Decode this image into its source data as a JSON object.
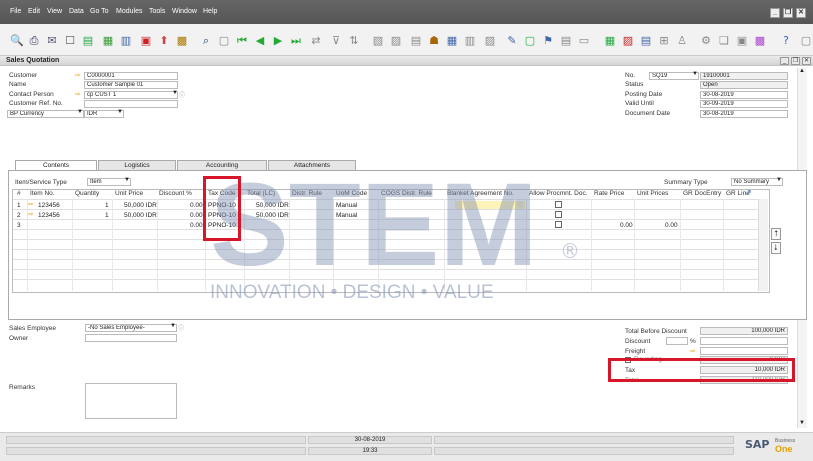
{
  "menu": [
    "File",
    "Edit",
    "View",
    "Data",
    "Go To",
    "Modules",
    "Tools",
    "Window",
    "Help"
  ],
  "toolbar_icons": [
    "print-preview-icon",
    "print-icon",
    "email-icon",
    "word-icon",
    "pdf-icon",
    "excel-icon",
    "launch-icon",
    "lock-icon",
    "filter-icon",
    "first-record-icon",
    "previous-record-icon",
    "next-record-icon",
    "last-record-icon",
    "refresh-icon",
    "find-icon",
    "base-document-icon",
    "target-document-icon",
    "gross-profit-icon",
    "payment-icon",
    "alerts-icon",
    "calendar-icon",
    "settings-icon",
    "tree-icon",
    "messages-icon",
    "form-settings-icon",
    "help-icon"
  ],
  "window": {
    "title": "Sales Quotation"
  },
  "header_left": {
    "customer_label": "Customer",
    "customer_value": "C0000001",
    "name_label": "Name",
    "name_value": "Customer Sample 01",
    "contact_label": "Contact Person",
    "contact_value": "cp CUST 1",
    "ref_label": "Customer Ref. No.",
    "ref_value": "",
    "currency_label": "BP Currency",
    "currency_value": "IDR"
  },
  "header_right": {
    "no_label": "No.",
    "series": "SQ19",
    "number": "19100001",
    "status_label": "Status",
    "status_value": "Open",
    "posting_label": "Posting Date",
    "posting_value": "30-08-2019",
    "valid_label": "Valid Until",
    "valid_value": "30-09-2019",
    "docdate_label": "Document Date",
    "docdate_value": "30-08-2019"
  },
  "tabs": [
    "Contents",
    "Logistics",
    "Accounting",
    "Attachments"
  ],
  "contents": {
    "item_type_label": "Item/Service Type",
    "item_type_value": "Item",
    "summary_label": "Summary Type",
    "summary_value": "No Summary",
    "columns": [
      "#",
      "Item No.",
      "Quantity",
      "Unit Price",
      "Discount %",
      "Tax Code",
      "Total (LC)",
      "Distr. Rule",
      "UoM Code",
      "COGS Distr. Rule",
      "Blanket Agreement No.",
      "Allow Procmnt. Doc.",
      "Rate Price",
      "Unit Prices",
      "GR DocEntry",
      "GR Line"
    ],
    "rows": [
      {
        "num": "1",
        "item": "123456",
        "qty": "1",
        "price": "50,000 IDR",
        "disc": "0.00",
        "tax": "PPNO-10",
        "total": "50,000 IDR",
        "uom": "Manual",
        "rate": "",
        "unit": ""
      },
      {
        "num": "2",
        "item": "123456",
        "qty": "1",
        "price": "50,000 IDR",
        "disc": "0.00",
        "tax": "PPNO-10",
        "total": "50,000 IDR",
        "uom": "Manual",
        "rate": "",
        "unit": ""
      },
      {
        "num": "3",
        "item": "",
        "qty": "",
        "price": "",
        "disc": "0.00",
        "tax": "PPNO-10",
        "total": "",
        "uom": "",
        "rate": "0.00",
        "unit": "0.00"
      }
    ]
  },
  "footer_left": {
    "sales_emp_label": "Sales Employee",
    "sales_emp_value": "-No Sales Employee-",
    "owner_label": "Owner",
    "owner_value": "",
    "remarks_label": "Remarks",
    "remarks_value": ""
  },
  "totals": {
    "before_disc_label": "Total Before Discount",
    "before_disc_value": "100,000 IDR",
    "discount_label": "Discount",
    "discount_pct_sign": "%",
    "freight_label": "Freight",
    "rounding_label": "Rounding",
    "rounding_value": "0 IDR",
    "tax_label": "Tax",
    "tax_value": "10,000 IDR",
    "total_label": "Total",
    "total_value": "110,000 IDR"
  },
  "watermark": {
    "brand": "STEM",
    "tagline": "INNOVATION • DESIGN • VALUE"
  },
  "status_bar": {
    "date": "30-08-2019",
    "time": "19:33"
  },
  "logo": {
    "brand": "SAP",
    "sub": "Business",
    "product": "One"
  },
  "colors": {
    "highlight": "#d7162a",
    "accent": "#e8a000",
    "menu_bg": "#555555"
  }
}
